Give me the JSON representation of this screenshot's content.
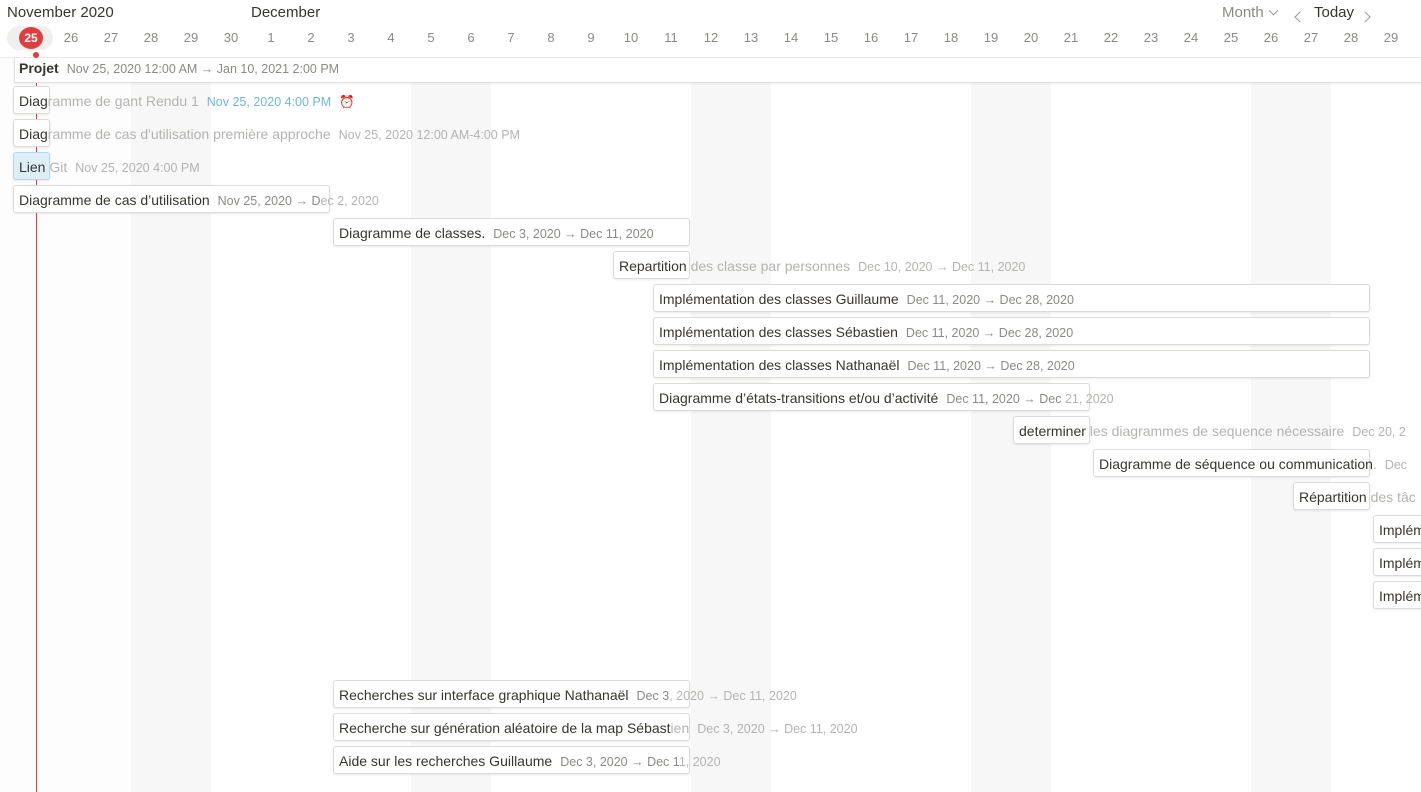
{
  "header": {
    "month_left": "November 2020",
    "month_right": "December",
    "view_label": "Month",
    "today_label": "Today",
    "today_day": "25",
    "days": [
      "25",
      "26",
      "27",
      "28",
      "29",
      "30",
      "1",
      "2",
      "3",
      "4",
      "5",
      "6",
      "7",
      "8",
      "9",
      "10",
      "11",
      "12",
      "13",
      "14",
      "15",
      "16",
      "17",
      "18",
      "19",
      "20",
      "21",
      "22",
      "23",
      "24",
      "25",
      "26",
      "27",
      "28",
      "29"
    ]
  },
  "project": {
    "title": "Projet",
    "dates": "Nov 25, 2020 12:00 AM → Jan 10, 2021 2:00 PM"
  },
  "tasks": [
    {
      "title_in": "Diag",
      "title_out": "ramme de gant Rendu 1",
      "dates": "Nov 25, 2020 4:00 PM",
      "alarm": "⏰"
    },
    {
      "title_in": "Diag",
      "title_out": "ramme de cas d'utilisation première approche",
      "dates": "Nov 25, 2020 12:00 AM-4:00 PM"
    },
    {
      "title_in": "Lien",
      "title_out": " Git",
      "dates": "Nov 25, 2020 4:00 PM"
    },
    {
      "title": "Diagramme de cas d’utilisation",
      "dates_in": "Nov 25, 2020 → D",
      "dates_out": "ec 2, 2020"
    },
    {
      "title": "Diagramme de classes.",
      "dates": "Dec 3, 2020 → Dec 11, 2020"
    },
    {
      "title_in": "Repartition",
      "title_out": " des classe par personnes",
      "dates": "Dec 10, 2020 → Dec 11, 2020"
    },
    {
      "title": "Implémentation des classes Guillaume",
      "dates": "Dec 11, 2020 → Dec 28, 2020"
    },
    {
      "title": "Implémentation des classes Sébastien",
      "dates": "Dec 11, 2020 → Dec 28, 2020"
    },
    {
      "title": "Implémentation des classes Nathanaël",
      "dates": "Dec 11, 2020 → Dec 28, 2020"
    },
    {
      "title": "Diagramme d’états-transitions et/ou d’activité",
      "dates_in": "Dec 11, 2020 → Dec",
      "dates_out": " 21, 2020"
    },
    {
      "title_in": "determiner",
      "title_out": " les diagrammes de sequence nécessaire",
      "dates": "Dec 20, 2"
    },
    {
      "title_in": "Diagramme de séquence ou communication",
      "title_out": ".",
      "dates": "Dec"
    },
    {
      "title_in": "Répartition",
      "title_out": " des tâc"
    },
    {
      "title": "Implém"
    },
    {
      "title": "Implém"
    },
    {
      "title": "Implém"
    },
    {
      "title_in": "Recherches sur interface graphique Nathanaël",
      "dates_in": "Dec 3",
      "dates_out": ", 2020 → Dec 11, 2020"
    },
    {
      "title_in": "Recherche sur génération aléatoire de la map Sébast",
      "title_out": "ien",
      "dates": "Dec 3, 2020 → Dec 11, 2020"
    },
    {
      "title": "Aide sur les recherches Guillaume",
      "dates_in": "Dec 3, 2020 → Dec 1",
      "dates_out": "1, 2020"
    }
  ]
}
